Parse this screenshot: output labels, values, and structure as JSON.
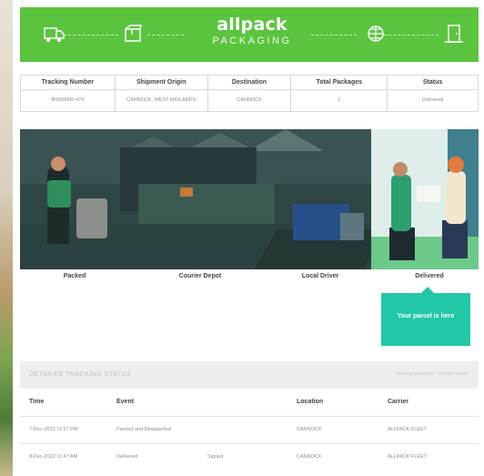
{
  "header": {
    "brand": "allpack",
    "brand_sub": "PACKAGING",
    "colors": {
      "bar": "#5bc43f",
      "accent": "#22c7a7"
    },
    "icons": [
      "truck-icon",
      "package-icon",
      "globe-icon",
      "door-icon"
    ]
  },
  "summary": {
    "headers": [
      "Tracking Number",
      "Shipment Origin",
      "Destination",
      "Total Packages",
      "Status"
    ],
    "row": [
      "BSW0000-474",
      "CANNOCK, WEST MIDLANDS",
      "CANNOCK",
      "1",
      "Delivered"
    ]
  },
  "steps": [
    "Packed",
    "Courier Depot",
    "Local Driver",
    "Delivered"
  ],
  "callout": "Your parcel is here",
  "detail": {
    "title": "DETAILED TRACKING STATUS",
    "hint": "Having problems? contact dealer"
  },
  "events": {
    "headers": [
      "Time",
      "Event",
      "",
      "Location",
      "Carrier"
    ],
    "rows": [
      [
        "7-Dec-2022 11:57 PM",
        "Packed and Despatched",
        "",
        "CANNOCK",
        "ALLPACK FLEET"
      ],
      [
        "8-Dec-2022 11:47 AM",
        "Delivered",
        "Signed",
        "CANNOCK",
        "ALLPACK FLEET"
      ]
    ]
  }
}
